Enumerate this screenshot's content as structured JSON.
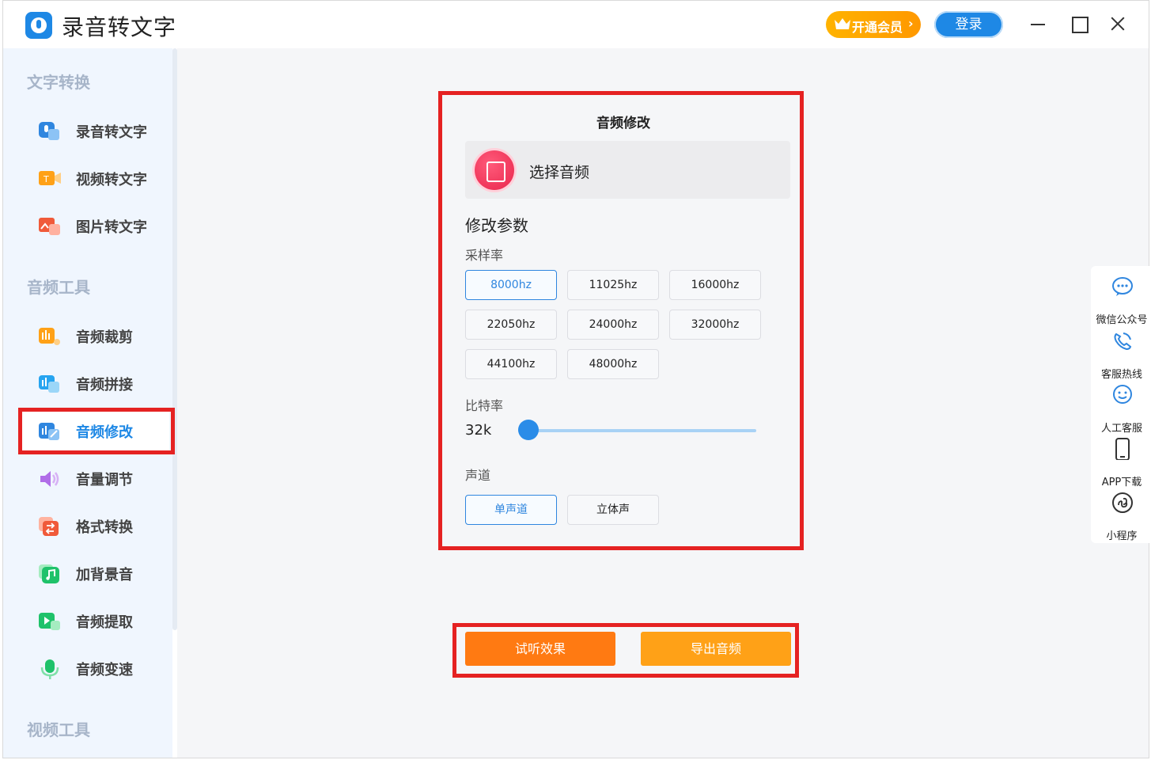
{
  "app": {
    "title": "录音转文字"
  },
  "header": {
    "vip_label": "开通会员",
    "login_label": "登录"
  },
  "sidebar": {
    "sections": [
      {
        "title": "文字转换"
      },
      {
        "title": "音频工具"
      },
      {
        "title": "视频工具"
      }
    ],
    "items": [
      {
        "label": "录音转文字",
        "icon": "audio-to-text-icon"
      },
      {
        "label": "视频转文字",
        "icon": "video-to-text-icon"
      },
      {
        "label": "图片转文字",
        "icon": "image-to-text-icon"
      },
      {
        "label": "音频裁剪",
        "icon": "audio-cut-icon"
      },
      {
        "label": "音频拼接",
        "icon": "audio-join-icon"
      },
      {
        "label": "音频修改",
        "icon": "audio-edit-icon",
        "active": true
      },
      {
        "label": "音量调节",
        "icon": "volume-icon"
      },
      {
        "label": "格式转换",
        "icon": "format-convert-icon"
      },
      {
        "label": "加背景音",
        "icon": "background-music-icon"
      },
      {
        "label": "音频提取",
        "icon": "audio-extract-icon"
      },
      {
        "label": "音频变速",
        "icon": "audio-speed-icon"
      }
    ]
  },
  "panel": {
    "title": "音频修改",
    "choose_audio": "选择音频",
    "params_title": "修改参数",
    "sample_rate": {
      "label": "采样率",
      "options": [
        "8000hz",
        "11025hz",
        "16000hz",
        "22050hz",
        "24000hz",
        "32000hz",
        "44100hz",
        "48000hz"
      ],
      "selected": "8000hz"
    },
    "bitrate": {
      "label": "比特率",
      "value": "32k",
      "slider_fraction": 0.0
    },
    "channel": {
      "label": "声道",
      "options": [
        "单声道",
        "立体声"
      ],
      "selected": "单声道"
    }
  },
  "actions": {
    "preview": "试听效果",
    "export": "导出音频"
  },
  "rightbar": {
    "items": [
      {
        "label": "微信公众号",
        "icon": "wechat-icon"
      },
      {
        "label": "客服热线",
        "icon": "phone-icon"
      },
      {
        "label": "人工客服",
        "icon": "chat-support-icon"
      },
      {
        "label": "APP下载",
        "icon": "mobile-icon"
      },
      {
        "label": "小程序",
        "icon": "mini-program-icon"
      }
    ]
  },
  "colors": {
    "accent": "#1e88e5",
    "highlight": "#e52222",
    "orange": "#ff7a12",
    "amber": "#ffa117"
  }
}
